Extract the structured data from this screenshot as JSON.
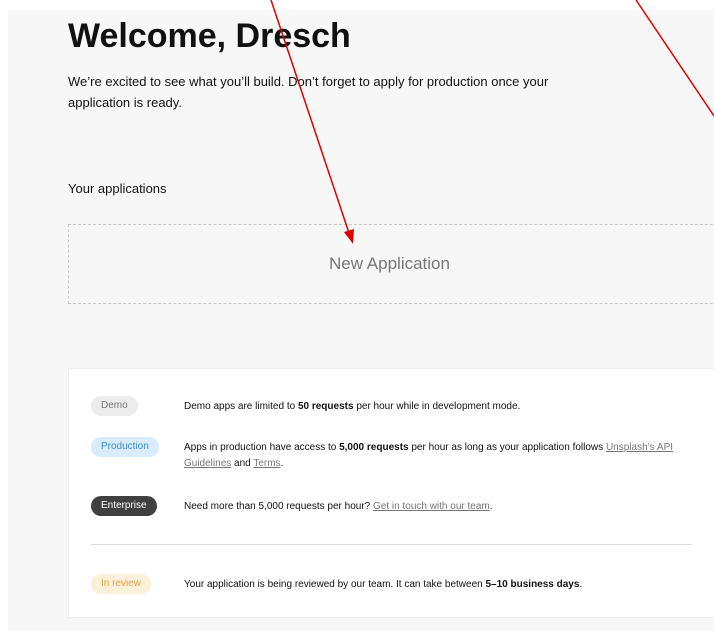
{
  "page_title": "Welcome, Dresch",
  "intro_text": "We’re excited to see what you’ll build. Don’t forget to apply for production once your application is ready.",
  "applications": {
    "section_label": "Your applications",
    "new_application_label": "New Application"
  },
  "tiers": {
    "demo": {
      "badge": "Demo",
      "text_before": "Demo apps are limited to ",
      "text_bold": "50 requests",
      "text_after": " per hour while in development mode."
    },
    "production": {
      "badge": "Production",
      "text_before": "Apps in production have access to ",
      "text_bold": "5,000 requests",
      "text_middle": " per hour as long as your application follows ",
      "link_guidelines": "Unsplash’s API Guidelines",
      "text_and": " and ",
      "link_terms": "Terms",
      "text_end": "."
    },
    "enterprise": {
      "badge": "Enterprise",
      "text_before": "Need more than 5,000 requests per hour? ",
      "link_contact": "Get in touch with our team",
      "text_end": "."
    },
    "in_review": {
      "badge": "In review",
      "text_before": "Your application is being reviewed by our team. It can take between ",
      "text_bold": "5–10 business days",
      "text_end": "."
    }
  },
  "colors": {
    "annotation_arrow": "#e00000",
    "panel_background": "#f7f7f7",
    "production_badge": "#d8ecfb",
    "enterprise_badge": "#404040",
    "in_review_badge": "#fdf0da"
  },
  "icons": {
    "annotation": "red-arrow-annotation"
  }
}
